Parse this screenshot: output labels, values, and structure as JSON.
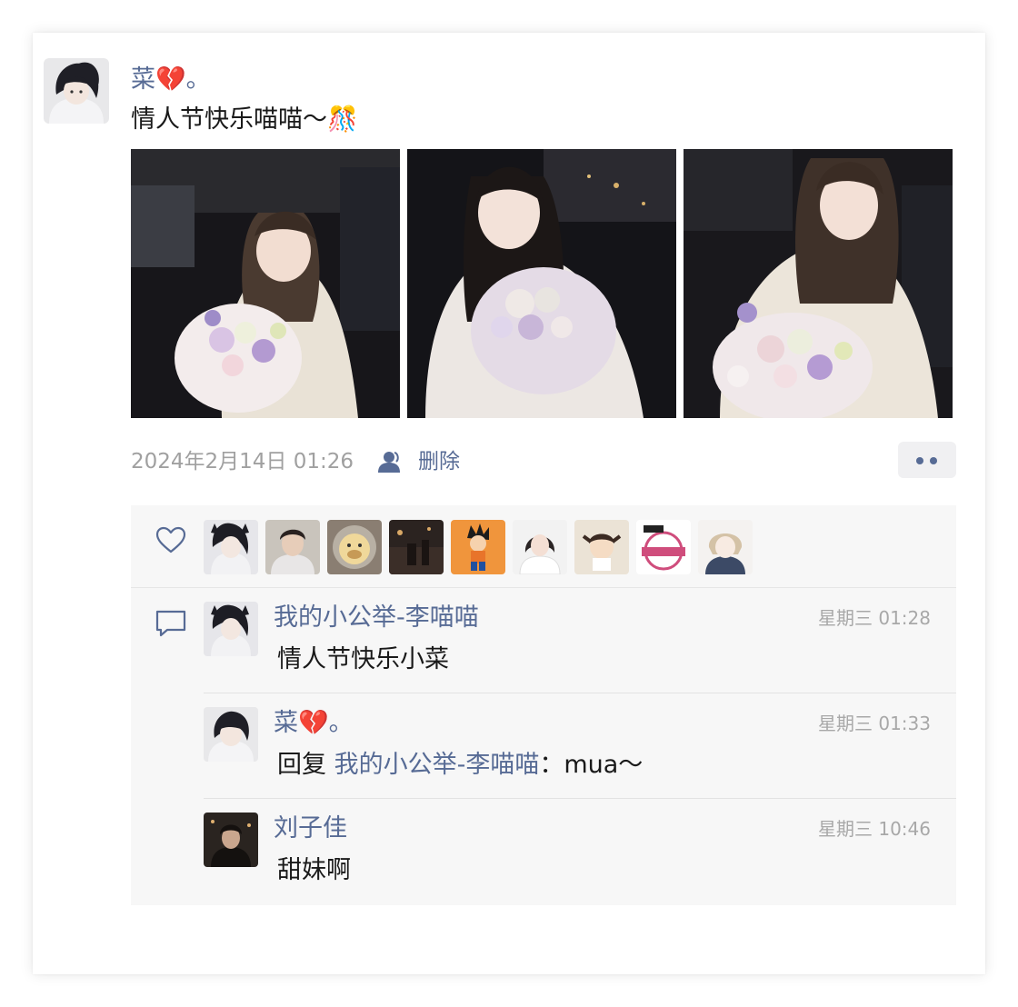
{
  "post": {
    "author": "菜💔。",
    "text": "情人节快乐喵喵～🎊",
    "timestamp": "2024年2月14日 01:26",
    "visibility_icon": "person-icon",
    "delete_label": "删除",
    "photos": [
      {
        "description_icon": "photo"
      },
      {
        "description_icon": "photo"
      },
      {
        "description_icon": "photo"
      }
    ]
  },
  "likes": {
    "icon": "heart-outline-icon",
    "count_avatars": 9
  },
  "comments_icon": "speech-bubble-icon",
  "comments": [
    {
      "author": "我的小公举-李喵喵",
      "time": "星期三 01:28",
      "text": "情人节快乐小菜",
      "reply_prefix": "",
      "reply_to": "",
      "reply_suffix": ""
    },
    {
      "author": "菜💔。",
      "time": "星期三 01:33",
      "text": "",
      "reply_prefix": "回复 ",
      "reply_to": "我的小公举-李喵喵",
      "reply_suffix": "：mua～"
    },
    {
      "author": "刘子佳",
      "time": "星期三 10:46",
      "text": "甜妹啊",
      "reply_prefix": "",
      "reply_to": "",
      "reply_suffix": ""
    }
  ],
  "colors": {
    "link": "#576b95",
    "text": "#1a1a1a",
    "meta": "#a0a0a0",
    "panel": "#f7f7f7"
  }
}
